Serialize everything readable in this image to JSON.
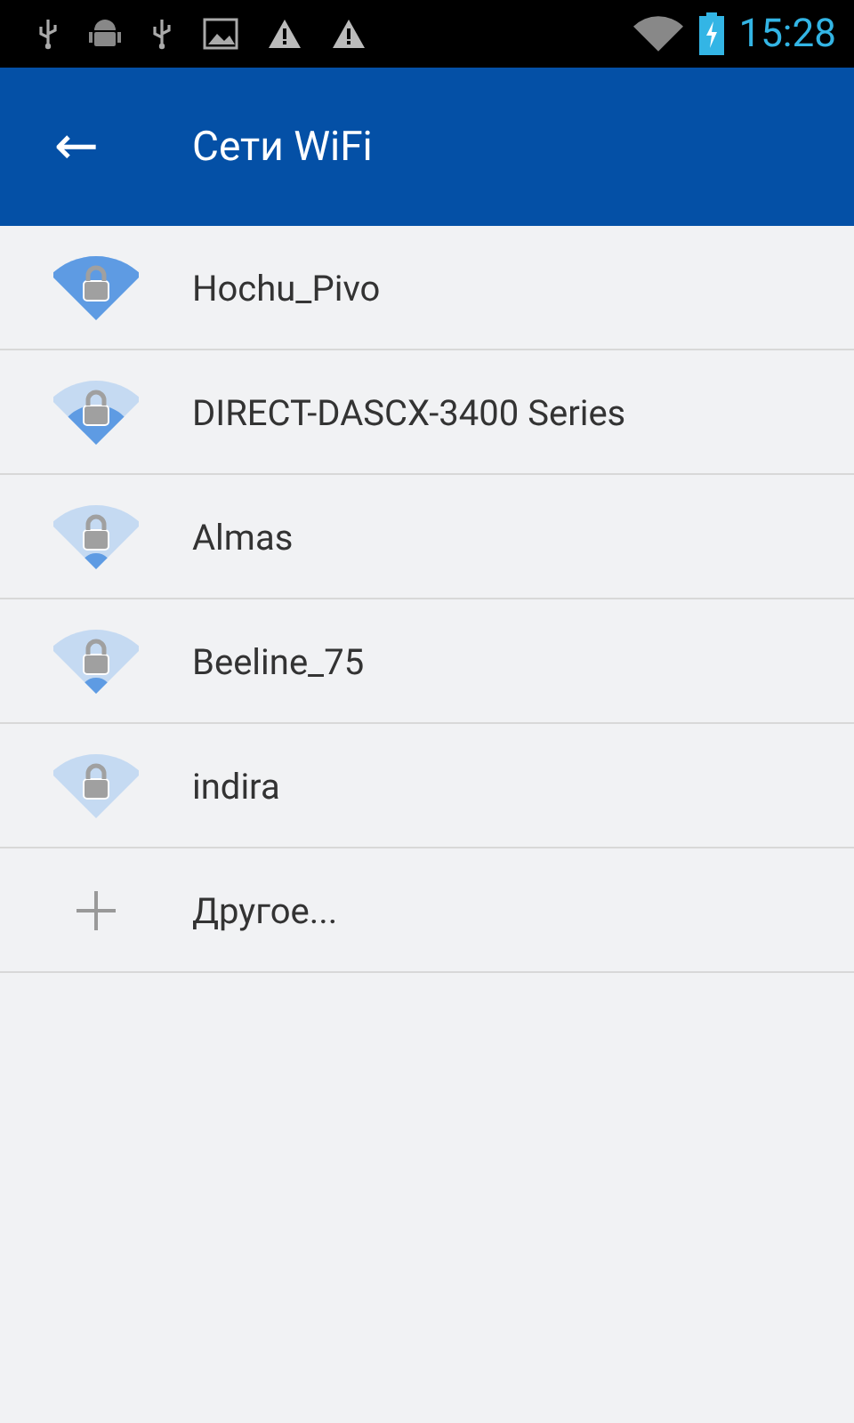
{
  "status_bar": {
    "time": "15:28"
  },
  "app_bar": {
    "back": "←",
    "title": "Сети WiFi"
  },
  "networks": [
    {
      "kind": "full",
      "name": "Hochu_Pivo"
    },
    {
      "kind": "good",
      "name": "DIRECT-DASCX-3400 Series"
    },
    {
      "kind": "weak",
      "name": "Almas"
    },
    {
      "kind": "weak",
      "name": "Beeline_75"
    },
    {
      "kind": "none",
      "name": "indira"
    },
    {
      "kind": "add",
      "name": "Другое..."
    }
  ]
}
